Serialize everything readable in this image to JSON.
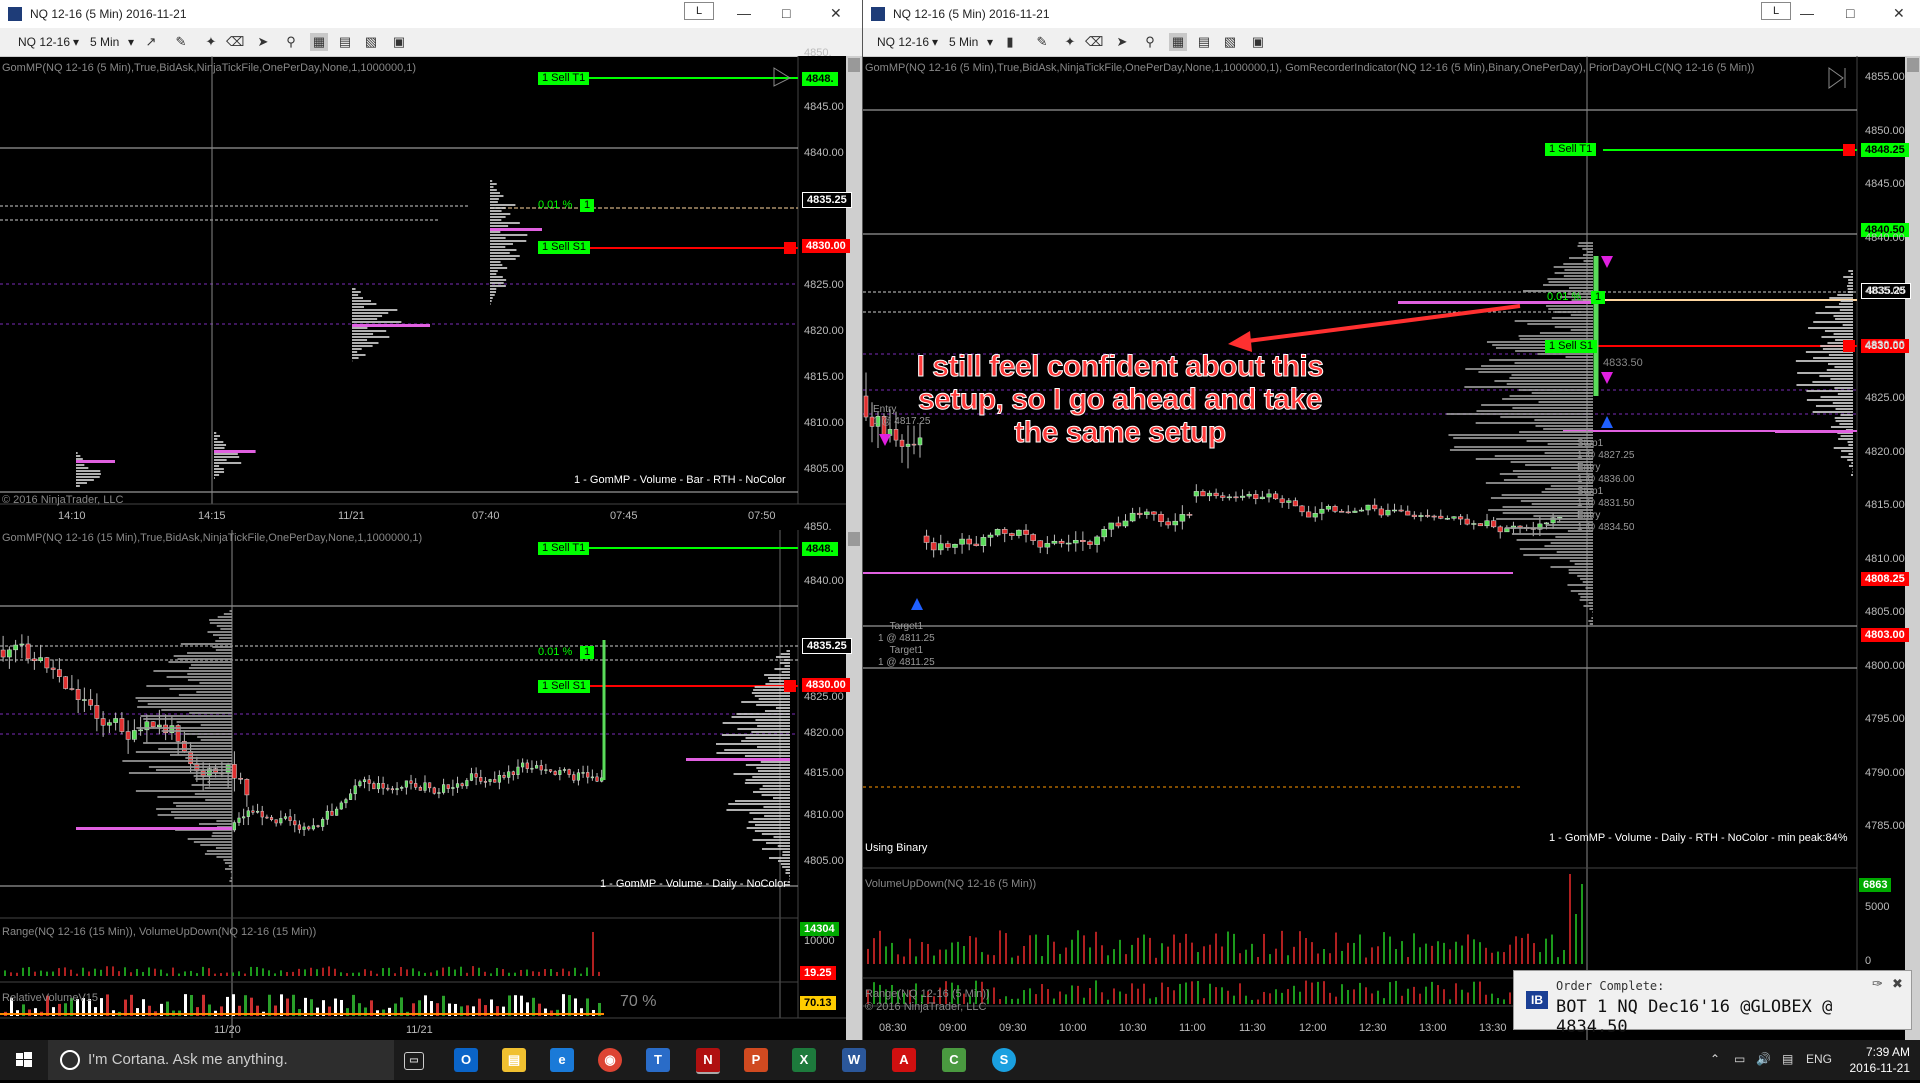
{
  "windows": [
    {
      "title": "NQ 12-16 (5 Min)  2016-11-21",
      "l_button": "L"
    },
    {
      "title": "NQ 12-16 (5 Min)  2016-11-21",
      "l_button": "L"
    }
  ],
  "toolbar": {
    "instrument": "NQ 12-16",
    "interval": "5 Min"
  },
  "left_top": {
    "indicator": "GomMP(NQ 12-16 (5 Min),True,BidAsk,NinjaTickFile,OnePerDay,None,1,1000000,1)",
    "footer": "1 - GomMP  - Volume - Bar - RTH - NoColor",
    "copyright": "© 2016 NinjaTrader, LLC",
    "price_ticks": [
      "4850.",
      "4845.00",
      "4840.00",
      "4835.25",
      "4830.00",
      "4825.00",
      "4820.00",
      "4815.00",
      "4810.00",
      "4805.00"
    ],
    "time_ticks": [
      "14:10",
      "14:15",
      "11/21",
      "07:40",
      "07:45",
      "07:50"
    ],
    "orders": {
      "t1": "1  Sell T1",
      "s1": "1  Sell S1",
      "pct": "0.01 %",
      "one": "1"
    },
    "labels": {
      "t1": "4848.",
      "mid": "4835.25",
      "s1": "4830.00"
    }
  },
  "left_bottom": {
    "indicator": "GomMP(NQ 12-16 (15 Min),True,BidAsk,NinjaTickFile,OnePerDay,None,1,1000000,1)",
    "footer": "1 - GomMP  - Volume - Daily - NoColor",
    "price_ticks": [
      "4850.",
      "4845.00",
      "4840.00",
      "4835.25",
      "4830.00",
      "4825.00",
      "4820.00",
      "4815.00",
      "4810.00",
      "4805.00"
    ],
    "orders": {
      "t1": "1  Sell T1",
      "s1": "1  Sell S1",
      "pct": "0.01 %",
      "one": "1"
    },
    "labels": {
      "t1": "4848.",
      "mid": "4835.25",
      "s1": "4830.00"
    },
    "sub_indicator": "Range(NQ 12-16 (15 Min)), VolumeUpDown(NQ 12-16 (15 Min))",
    "sub_ticks": [
      "10000"
    ],
    "sub_labels": {
      "vol": "14304",
      "range": "19.25"
    },
    "rel_vol": "RelativeVolumeV15",
    "rel_pct": "70 %",
    "rel_label": "70.13",
    "time_ticks": [
      "11/20",
      "11/21"
    ]
  },
  "right": {
    "indicator": "GomMP(NQ 12-16 (5 Min),True,BidAsk,NinjaTickFile,OnePerDay,None,1,1000000,1), GomRecorderIndicator(NQ 12-16 (5 Min),Binary,OnePerDay), PriorDayOHLC(NQ 12-16 (5 Min))",
    "footer": "1 - GomMP  - Volume - Daily - RTH - NoColor - min peak:84%",
    "using_binary": "Using Binary",
    "price_ticks": [
      "4855.00",
      "4850.00",
      "4845.00",
      "4840.00",
      "4835.00",
      "4830.00",
      "4825.00",
      "4820.00",
      "4815.00",
      "4810.00",
      "4805.00",
      "4800.00",
      "4795.00",
      "4790.00",
      "4785.00"
    ],
    "orders": {
      "t1": "1  Sell T1",
      "s1": "1  Sell S1",
      "pct": "0.01 %",
      "one": "1",
      "avg": "4833.50"
    },
    "labels": {
      "t1": "4848.25",
      "high": "4840.50",
      "mid": "4835.25",
      "s1": "4830.00",
      "lowA": "4808.25",
      "lowB": "4803.00"
    },
    "trade_notes": {
      "entry1": "Entry\n1 @ 4817.25",
      "target1": "Target1\n1 @ 4811.25\nTarget1\n1 @ 4811.25",
      "stop_entry": "Stop1\n1 @ 4827.25\nEntry\n1 @ 4836.00\nStop1\n1 @ 4831.50\nEntry\n1 @ 4834.50"
    },
    "vol_indicator": "VolumeUpDown(NQ 12-16 (5 Min))",
    "vol_ticks": [
      "5000",
      "0"
    ],
    "vol_label": "6863",
    "range_indicator": "Range(NQ 12-16 (5 Min))",
    "copyright": "© 2016 NinjaTrader, LLC",
    "time_ticks": [
      "08:30",
      "09:00",
      "09:30",
      "10:00",
      "10:30",
      "11:00",
      "11:30",
      "12:00",
      "12:30",
      "13:00",
      "13:30"
    ]
  },
  "annotation": "I still feel confident about this setup, so I go ahead and take the same setup",
  "toast": {
    "title": "Order Complete:",
    "message": "BOT 1 NQ Dec16'16 @GLOBEX @ 4834.50",
    "brand": "IB"
  },
  "taskbar": {
    "search_placeholder": "I'm Cortana. Ask me anything.",
    "lang": "ENG",
    "time": "7:39 AM",
    "date": "2016-11-21"
  },
  "colors": {
    "green_tag": "#00ff00",
    "red_price": "#ff0000",
    "annotation": "#ff3b3b",
    "profile_magenta": "#e060e0"
  }
}
